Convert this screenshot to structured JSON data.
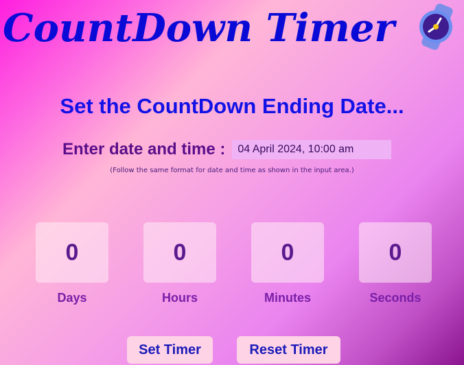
{
  "header": {
    "title": "CountDown Timer",
    "icon": "stopwatch-icon"
  },
  "main": {
    "heading": "Set the CountDown Ending Date...",
    "entry_label": "Enter date and time :",
    "date_input_value": "04 April 2024, 10:00 am",
    "hint": "(Follow the same format for date and time as shown in the input area.)"
  },
  "counters": [
    {
      "value": "0",
      "label": "Days"
    },
    {
      "value": "0",
      "label": "Hours"
    },
    {
      "value": "0",
      "label": "Minutes"
    },
    {
      "value": "0",
      "label": "Seconds"
    }
  ],
  "buttons": {
    "set_label": "Set Timer",
    "reset_label": "Reset Timer"
  },
  "colors": {
    "title": "#0a0ad6",
    "heading": "#1212e6",
    "counter_text": "#5a1a8e",
    "button_bg": "#ffd3e6"
  }
}
